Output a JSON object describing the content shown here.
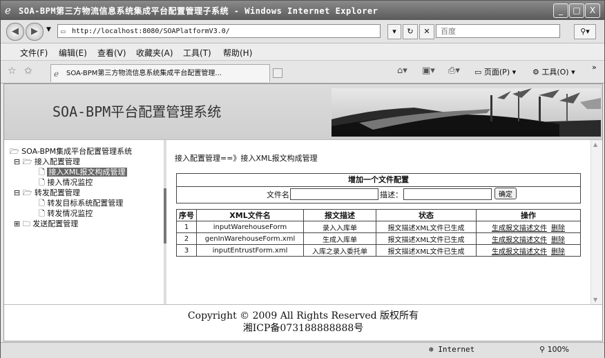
{
  "window": {
    "title": "SOA-BPM第三方物流信息系统集成平台配置管理子系统 - Windows Internet Explorer",
    "controls": [
      "_",
      "□",
      "X"
    ]
  },
  "addressbar": {
    "url": "http://localhost:8080/SOAPlatformV3.0/",
    "search_placeholder": "百度"
  },
  "menubar": [
    "文件(F)",
    "编辑(E)",
    "查看(V)",
    "收藏夹(A)",
    "工具(T)",
    "帮助(H)"
  ],
  "favbar": {
    "tab_title": "SOA-BPM第三方物流信息系统集成平台配置管理...",
    "page_menu": "页面(P)",
    "tools_menu": "工具(O)"
  },
  "banner": {
    "title": "SOA-BPM平台配置管理系统"
  },
  "tree": [
    "SOA-BPM集成平台配置管理系统",
    "接入配置管理",
    "接入XML报文构成管理",
    "接入情况监控",
    "转发配置管理",
    "转发目标系统配置管理",
    "转发情况监控",
    "发送配置管理"
  ],
  "breadcrumb": "接入配置管理==》接入XML报文构成管理",
  "form": {
    "title": "增加一个文件配置",
    "filename_label": "文件名：",
    "desc_label": "描述：",
    "ok": "确定"
  },
  "table": {
    "headers": [
      "序号",
      "XML文件名",
      "报文描述",
      "状态",
      "操作"
    ],
    "rows": [
      [
        "1",
        "inputWarehouseForm",
        "录入入库单",
        "报文描述XML文件已生成"
      ],
      [
        "2",
        "genInWarehouseForm.xml",
        "生成入库单",
        "报文描述XML文件已生成"
      ],
      [
        "3",
        "inputEntrustForm.xml",
        "入库之录入委托单",
        "报文描述XML文件已生成"
      ]
    ],
    "op_generate": "生成报文描述文件",
    "op_delete": "删除"
  },
  "footer": {
    "line1": "Copyright © 2009    All Rights Reserved 版权所有",
    "line2": "湘ICP备073188888888号"
  },
  "statusbar": {
    "zone": "Internet",
    "zoom": "100%"
  }
}
